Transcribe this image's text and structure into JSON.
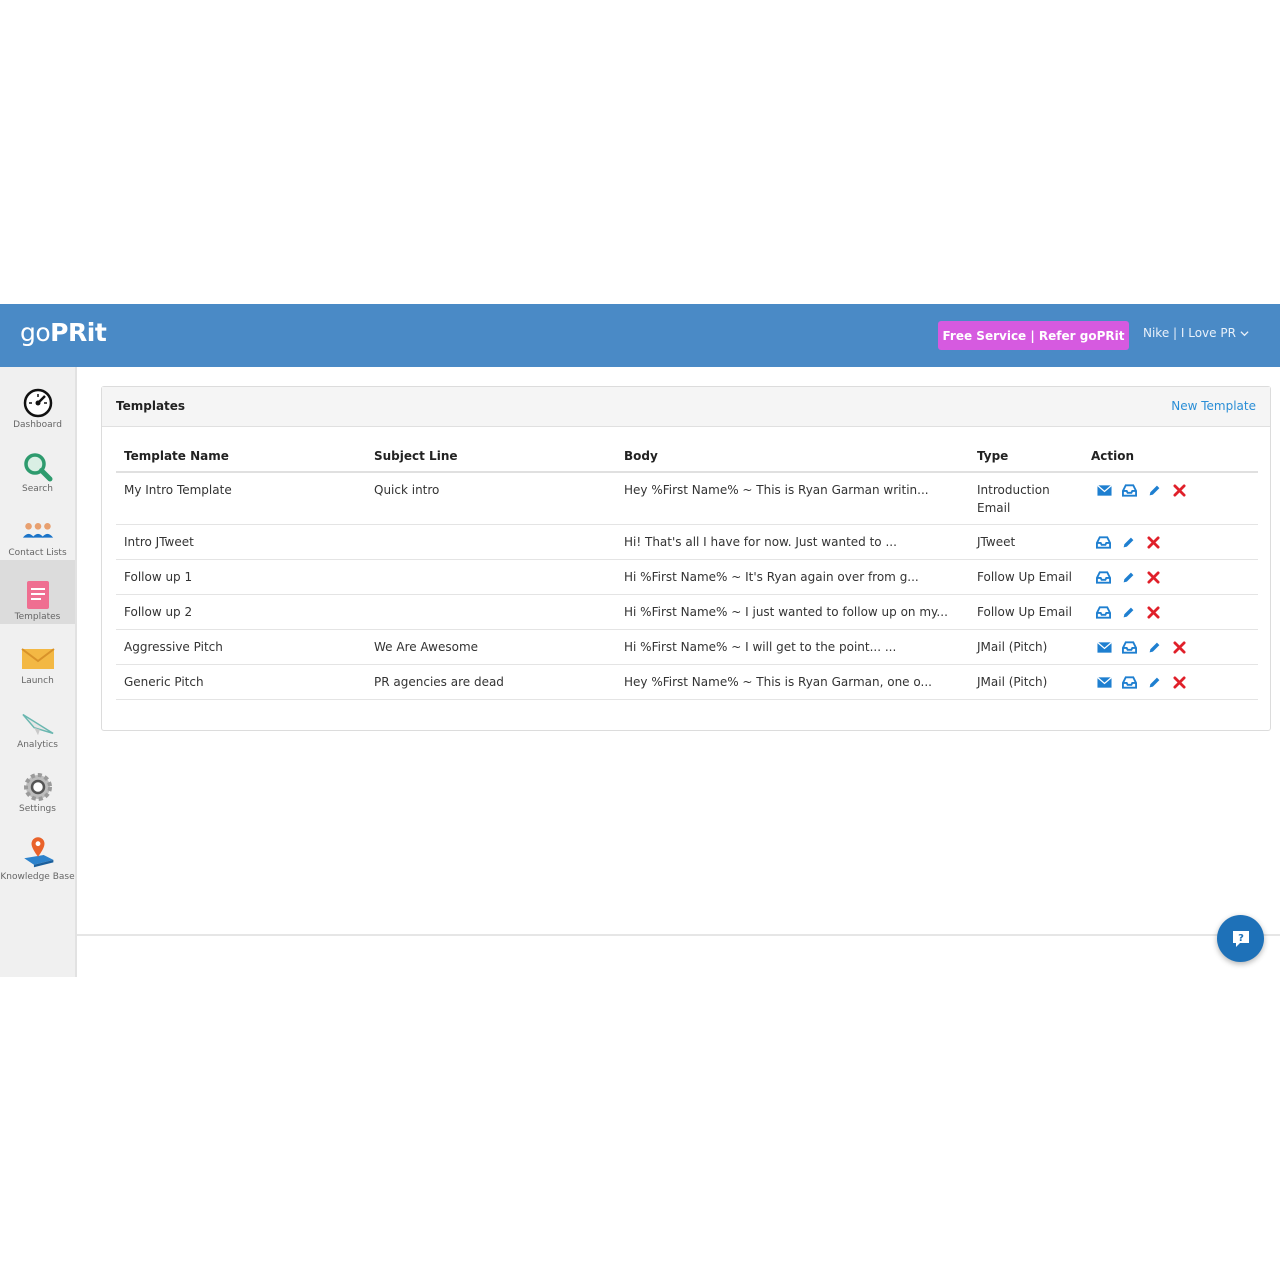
{
  "header": {
    "logo_go": "go",
    "logo_prit": "PRit",
    "refer_label": "Free Service | Refer goPRit",
    "user_label": "Nike | I Love PR",
    "bar_color": "#4a8ac6",
    "refer_color": "#d65ae0"
  },
  "sidebar": {
    "items": [
      {
        "label": "Dashboard",
        "icon": "speedometer-icon"
      },
      {
        "label": "Search",
        "icon": "magnifier-icon"
      },
      {
        "label": "Contact Lists",
        "icon": "people-icon"
      },
      {
        "label": "Templates",
        "icon": "document-icon",
        "active": true
      },
      {
        "label": "Launch",
        "icon": "envelope-icon"
      },
      {
        "label": "Analytics",
        "icon": "paper-plane-icon"
      },
      {
        "label": "Settings",
        "icon": "gear-icon"
      },
      {
        "label": "Knowledge Base",
        "icon": "map-pin-book-icon"
      }
    ]
  },
  "panel": {
    "title": "Templates",
    "new_template_label": "New Template"
  },
  "table": {
    "headers": [
      "Template Name",
      "Subject Line",
      "Body",
      "Type",
      "Action"
    ],
    "rows": [
      {
        "name": "My Intro Template",
        "subject": "Quick intro",
        "body": "Hey %First Name% ~ This is Ryan Garman writin...",
        "type": "Introduction Email",
        "actions": [
          "email",
          "inbox",
          "edit",
          "delete"
        ]
      },
      {
        "name": "Intro JTweet",
        "subject": "",
        "body": "Hi!  That's all I have for now.  Just wanted to ...",
        "type": "JTweet",
        "actions": [
          "inbox",
          "edit",
          "delete"
        ]
      },
      {
        "name": "Follow up 1",
        "subject": "",
        "body": "Hi %First Name% ~ It's Ryan again over from g...",
        "type": "Follow Up Email",
        "actions": [
          "inbox",
          "edit",
          "delete"
        ]
      },
      {
        "name": "Follow up 2",
        "subject": "",
        "body": "Hi %First Name% ~ I just wanted to follow up on my...",
        "type": "Follow Up Email",
        "actions": [
          "inbox",
          "edit",
          "delete"
        ]
      },
      {
        "name": "Aggressive Pitch",
        "subject": "We Are Awesome",
        "body": "Hi %First Name% ~ I will get to the point... ...",
        "type": "JMail (Pitch)",
        "actions": [
          "email",
          "inbox",
          "edit",
          "delete"
        ]
      },
      {
        "name": "Generic Pitch",
        "subject": "PR agencies are dead",
        "body": "Hey %First Name% ~ This is Ryan Garman, one o...",
        "type": "JMail (Pitch)",
        "actions": [
          "email",
          "inbox",
          "edit",
          "delete"
        ]
      }
    ]
  },
  "colors": {
    "action_blue": "#1e7fd0",
    "delete_red": "#e0202a",
    "link_blue": "#2a8ed6"
  }
}
